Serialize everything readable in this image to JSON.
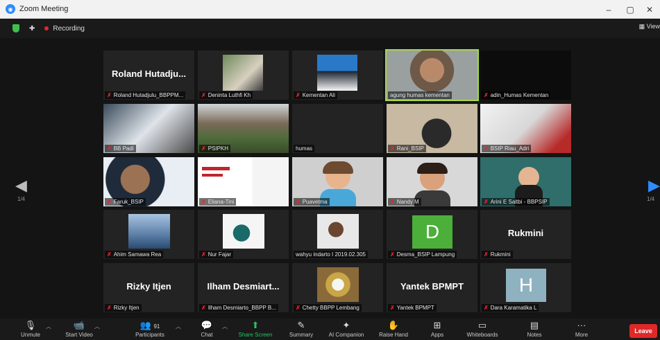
{
  "window": {
    "title": "Zoom Meeting",
    "minimize": "–",
    "maximize": "▢",
    "close": "✕"
  },
  "topbar": {
    "recording": "Recording",
    "view": "View"
  },
  "pagination": {
    "left_page": "1/4",
    "right_page": "1/4"
  },
  "tiles": [
    {
      "label": "Roland Hutadjulu_BBPPM...",
      "big": "Roland  Hutadju..."
    },
    {
      "label": "Deninta Luthfi Kh"
    },
    {
      "label": "Kementan Ali"
    },
    {
      "label": "agung humas kementan"
    },
    {
      "label": "adin_Humas Kementan"
    },
    {
      "label": "BB Padi"
    },
    {
      "label": "PSIPKH"
    },
    {
      "label": "humas"
    },
    {
      "label": "Rani_BSIP"
    },
    {
      "label": "BSIP Riau_Adri"
    },
    {
      "label": "Faruk_BSIP"
    },
    {
      "label": "Eliana-Tini"
    },
    {
      "label": "Puavetma"
    },
    {
      "label": "Nandy M"
    },
    {
      "label": "Arini E Saltbi - BBPSIP"
    },
    {
      "label": "Ahim Samawa Rea"
    },
    {
      "label": "Nur Fajar"
    },
    {
      "label": "wahyu indarto I 2019.02.305"
    },
    {
      "label": "Desma_BSIP Lampung",
      "letter": "D"
    },
    {
      "label": "Rukmini",
      "big": "Rukmini"
    },
    {
      "label": "Rizky Itjen",
      "big": "Rizky Itjen"
    },
    {
      "label": "Ilham Desmiarto_BBPP B...",
      "big": "Ilham  Desmiart..."
    },
    {
      "label": "Chetty BBPP Lembang"
    },
    {
      "label": "Yantek BPMPT",
      "big": "Yantek BPMPT"
    },
    {
      "label": "Dara Karamatika L",
      "letter": "H"
    }
  ],
  "toolbar": {
    "unmute": "Unmute",
    "start_video": "Start Video",
    "participants": "Participants",
    "participant_count": "91",
    "chat": "Chat",
    "share_screen": "Share Screen",
    "summary": "Summary",
    "ai_companion": "AI Companion",
    "raise_hand": "Raise Hand",
    "apps": "Apps",
    "whiteboards": "Whiteboards",
    "notes": "Notes",
    "more": "More",
    "leave": "Leave"
  },
  "colors": {
    "active_border": "#a7d84a",
    "share_green": "#22c55e",
    "leave_red": "#e02828",
    "desma_tile": "#4caf3a",
    "dara_tile": "#8fb2c0"
  }
}
